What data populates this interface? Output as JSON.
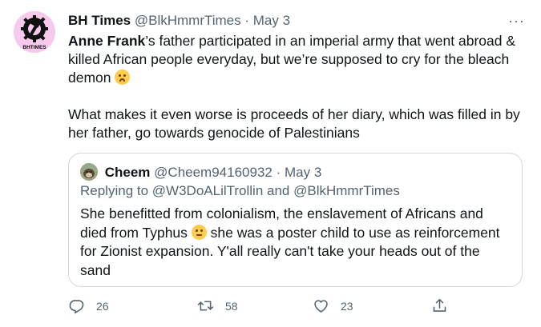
{
  "tweet": {
    "author_name": "BH Times",
    "author_handle": "@BlkHmmrTimes",
    "separator": "·",
    "date": "May 3",
    "avatar_text": "BHTIMES",
    "more_label": "···",
    "text_bold": "Anne Frank",
    "text_line1_rest": "’s father participated in an imperial army that went abroad & killed African people everyday, but we’re supposed to cry for the bleach demon ",
    "text_emoji": "woozy-face-emoji",
    "text_para2": "What makes it even worse is proceeds of her diary, which was filled in by her father, go towards genocide of Palestinians"
  },
  "quote": {
    "author_name": "Cheem",
    "author_handle": "@Cheem94160932",
    "separator": "·",
    "date": "May 3",
    "reply_prefix": "Replying to ",
    "reply_user1": "@W3DoALilTrollin",
    "reply_and": " and ",
    "reply_user2": "@BlkHmmrTimes",
    "text_part1": "She benefitted from colonialism, the enslavement of Africans and died from Typhus ",
    "text_emoji": "neutral-face-emoji",
    "text_part2": " she was a poster child to use as reinforcement for Zionist expansion. Y'all really can't take your heads out of the sand"
  },
  "actions": {
    "reply_count": "26",
    "retweet_count": "58",
    "like_count": "23"
  },
  "colors": {
    "text": "#0f1419",
    "secondary": "#536471",
    "border": "#cfd9de",
    "avatar_bg": "#f7c9ec"
  }
}
